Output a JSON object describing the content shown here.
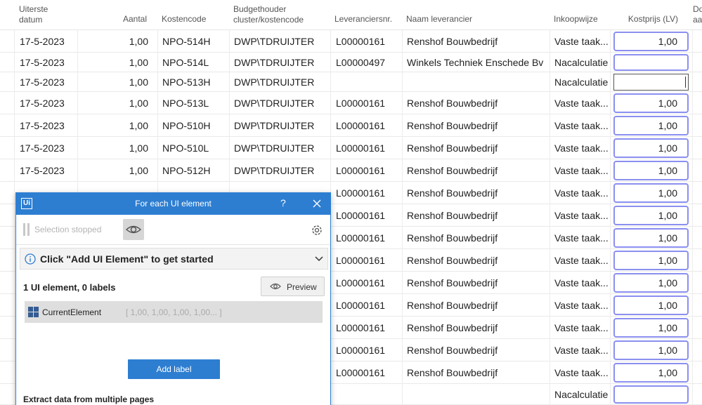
{
  "table": {
    "headers": {
      "uiterste_datum": [
        "Uiterste",
        "datum"
      ],
      "aantal": "Aantal",
      "kostencode": "Kostencode",
      "budgethouder": [
        "Budgethouder",
        "cluster/kostencode"
      ],
      "leveranciersnr": "Leveranciersnr.",
      "naam_leverancier": "Naam leverancier",
      "inkoopwijze": "Inkoopwijze",
      "kostprijs": "Kostprijs (LV)",
      "cut_column": [
        "Do",
        "aa"
      ]
    },
    "rows": [
      {
        "datum": "17-5-2023",
        "aantal": "1,00",
        "kostencode": "NPO-514H",
        "budget": "DWP\\TDRUIJTER",
        "levnr": "L00000161",
        "naam": "Renshof Bouwbedrijf",
        "inkoop": "Vaste taak...",
        "kostprijs": "1,00"
      },
      {
        "datum": "17-5-2023",
        "aantal": "1,00",
        "kostencode": "NPO-514L",
        "budget": "DWP\\TDRUIJTER",
        "levnr": "L00000497",
        "naam": "Winkels Techniek Enschede Bv",
        "inkoop": "Nacalculatie",
        "kostprijs": ""
      },
      {
        "datum": "17-5-2023",
        "aantal": "1,00",
        "kostencode": "NPO-513H",
        "budget": "DWP\\TDRUIJTER",
        "levnr": "",
        "naam": "",
        "inkoop": "Nacalculatie",
        "kostprijs": ""
      },
      {
        "datum": "17-5-2023",
        "aantal": "1,00",
        "kostencode": "NPO-513L",
        "budget": "DWP\\TDRUIJTER",
        "levnr": "L00000161",
        "naam": "Renshof Bouwbedrijf",
        "inkoop": "Vaste taak...",
        "kostprijs": "1,00"
      },
      {
        "datum": "17-5-2023",
        "aantal": "1,00",
        "kostencode": "NPO-510H",
        "budget": "DWP\\TDRUIJTER",
        "levnr": "L00000161",
        "naam": "Renshof Bouwbedrijf",
        "inkoop": "Vaste taak...",
        "kostprijs": "1,00"
      },
      {
        "datum": "17-5-2023",
        "aantal": "1,00",
        "kostencode": "NPO-510L",
        "budget": "DWP\\TDRUIJTER",
        "levnr": "L00000161",
        "naam": "Renshof Bouwbedrijf",
        "inkoop": "Vaste taak...",
        "kostprijs": "1,00"
      },
      {
        "datum": "17-5-2023",
        "aantal": "1,00",
        "kostencode": "NPO-512H",
        "budget": "DWP\\TDRUIJTER",
        "levnr": "L00000161",
        "naam": "Renshof Bouwbedrijf",
        "inkoop": "Vaste taak...",
        "kostprijs": "1,00"
      },
      {
        "datum": "",
        "aantal": "",
        "kostencode": "",
        "budget": "",
        "levnr": "L00000161",
        "naam": "Renshof Bouwbedrijf",
        "inkoop": "Vaste taak...",
        "kostprijs": "1,00"
      },
      {
        "datum": "",
        "aantal": "",
        "kostencode": "",
        "budget": "",
        "levnr": "L00000161",
        "naam": "Renshof Bouwbedrijf",
        "inkoop": "Vaste taak...",
        "kostprijs": "1,00"
      },
      {
        "datum": "",
        "aantal": "",
        "kostencode": "",
        "budget": "",
        "levnr": "L00000161",
        "naam": "Renshof Bouwbedrijf",
        "inkoop": "Vaste taak...",
        "kostprijs": "1,00"
      },
      {
        "datum": "",
        "aantal": "",
        "kostencode": "",
        "budget": "",
        "levnr": "L00000161",
        "naam": "Renshof Bouwbedrijf",
        "inkoop": "Vaste taak...",
        "kostprijs": "1,00"
      },
      {
        "datum": "",
        "aantal": "",
        "kostencode": "",
        "budget": "",
        "levnr": "L00000161",
        "naam": "Renshof Bouwbedrijf",
        "inkoop": "Vaste taak...",
        "kostprijs": "1,00"
      },
      {
        "datum": "",
        "aantal": "",
        "kostencode": "",
        "budget": "",
        "levnr": "L00000161",
        "naam": "Renshof Bouwbedrijf",
        "inkoop": "Vaste taak...",
        "kostprijs": "1,00"
      },
      {
        "datum": "",
        "aantal": "",
        "kostencode": "",
        "budget": "",
        "levnr": "L00000161",
        "naam": "Renshof Bouwbedrijf",
        "inkoop": "Vaste taak...",
        "kostprijs": "1,00"
      },
      {
        "datum": "",
        "aantal": "",
        "kostencode": "",
        "budget": "",
        "levnr": "L00000161",
        "naam": "Renshof Bouwbedrijf",
        "inkoop": "Vaste taak...",
        "kostprijs": "1,00"
      },
      {
        "datum": "",
        "aantal": "",
        "kostencode": "",
        "budget": "",
        "levnr": "L00000161",
        "naam": "Renshof Bouwbedrijf",
        "inkoop": "Vaste taak...",
        "kostprijs": "1,00"
      },
      {
        "datum": "",
        "aantal": "",
        "kostencode": "",
        "budget": "",
        "levnr": "",
        "naam": "",
        "inkoop": "Nacalculatie",
        "kostprijs": ""
      }
    ]
  },
  "dialog": {
    "logo": "Ui",
    "title": "For each UI element",
    "help": "?",
    "selection_status": "Selection stopped",
    "banner": "Click \"Add UI Element\" to get started",
    "count": "1 UI element, 0 labels",
    "preview": "Preview",
    "element_name": "CurrentElement",
    "element_value": "[ 1,00, 1,00, 1,00, 1,00... ]",
    "add_label": "Add label",
    "extract": "Extract data from multiple pages"
  },
  "colors": {
    "accent": "#2d7ed1",
    "input_border": "#8b8ff0",
    "element_icon": "#345c92"
  },
  "icons": [
    "pause-icon",
    "eye-icon",
    "gear-icon",
    "info-icon",
    "chevron-down-icon",
    "close-icon",
    "grid-icon"
  ]
}
